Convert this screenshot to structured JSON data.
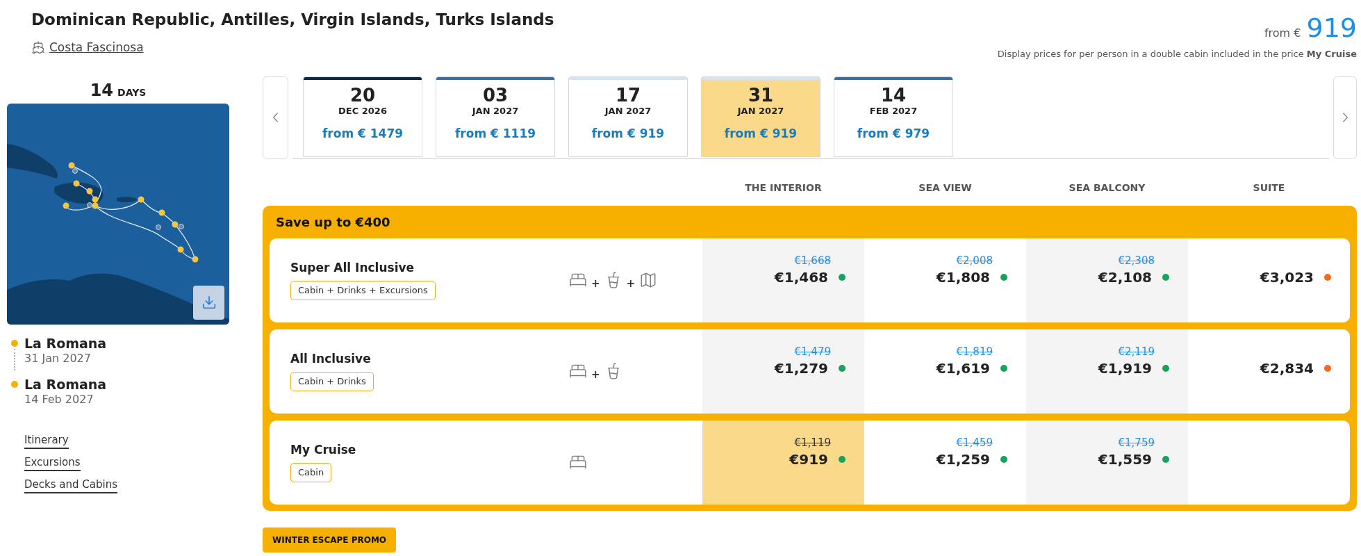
{
  "trip": {
    "title": "Dominican Republic, Antilles, Virgin Islands, Turks Islands",
    "ship": "Costa Fascinosa"
  },
  "from_price": {
    "label": "from €",
    "amount": "919"
  },
  "price_note": "Display prices for per person in a double cabin included in the price **My Cruise**",
  "duration": {
    "number": "14",
    "unit": "DAYS"
  },
  "itinerary": [
    {
      "port": "La Romana",
      "date": "31 Jan 2027"
    },
    {
      "port": "La Romana",
      "date": "14 Feb 2027"
    }
  ],
  "links": [
    "Itinerary",
    "Excursions",
    "Decks and Cabins"
  ],
  "dates": [
    {
      "day": "20",
      "month": "DEC 2026",
      "price": "from € 1479",
      "color": "#0d2b45",
      "selected": false
    },
    {
      "day": "03",
      "month": "JAN 2027",
      "price": "from € 1119",
      "color": "#3a6f9e",
      "selected": false
    },
    {
      "day": "17",
      "month": "JAN 2027",
      "price": "from € 919",
      "color": "#d3e5f4",
      "selected": false
    },
    {
      "day": "31",
      "month": "JAN 2027",
      "price": "from € 919",
      "color": "#d3e5f4",
      "selected": true
    },
    {
      "day": "14",
      "month": "FEB 2027",
      "price": "from € 979",
      "color": "#3a6f9e",
      "selected": false
    }
  ],
  "cabin_columns": [
    "THE INTERIOR",
    "SEA VIEW",
    "SEA BALCONY",
    "SUITE"
  ],
  "offer": {
    "banner": "Save up to €400",
    "fares": [
      {
        "name": "Super All Inclusive",
        "tag": "Cabin + Drinks + Excursions",
        "inclusions": [
          {
            "kind": "cabin"
          },
          {
            "kind": "plus",
            "text": "+"
          },
          {
            "kind": "drinks"
          },
          {
            "kind": "plus",
            "text": "+"
          },
          {
            "kind": "excursions"
          }
        ],
        "prices": [
          {
            "old": "€1,668",
            "price": "€1,468",
            "color": "#17a35e",
            "selected": false
          },
          {
            "old": "€2,008",
            "price": "€1,808",
            "color": "#17a35e",
            "selected": false
          },
          {
            "old": "€2,308",
            "price": "€2,108",
            "color": "#17a35e",
            "selected": false
          },
          {
            "price": "€3,023",
            "color": "#f26b1d",
            "selected": false
          }
        ]
      },
      {
        "name": "All Inclusive",
        "tag": "Cabin + Drinks",
        "inclusions": [
          {
            "kind": "cabin"
          },
          {
            "kind": "plus",
            "text": "+"
          },
          {
            "kind": "drinks"
          }
        ],
        "prices": [
          {
            "old": "€1,479",
            "price": "€1,279",
            "color": "#17a35e",
            "selected": false
          },
          {
            "old": "€1,819",
            "price": "€1,619",
            "color": "#17a35e",
            "selected": false
          },
          {
            "old": "€2,119",
            "price": "€1,919",
            "color": "#17a35e",
            "selected": false
          },
          {
            "price": "€2,834",
            "color": "#f26b1d",
            "selected": false
          }
        ]
      },
      {
        "name": "My Cruise",
        "tag": "Cabin",
        "inclusions": [
          {
            "kind": "cabin"
          }
        ],
        "prices": [
          {
            "old": "€1,119",
            "price": "€919",
            "color": "#17a35e",
            "selected": true
          },
          {
            "old": "€1,459",
            "price": "€1,259",
            "color": "#17a35e",
            "selected": false
          },
          {
            "old": "€1,759",
            "price": "€1,559",
            "color": "#17a35e",
            "selected": false
          }
        ]
      }
    ]
  },
  "promo": "WINTER ESCAPE PROMO"
}
